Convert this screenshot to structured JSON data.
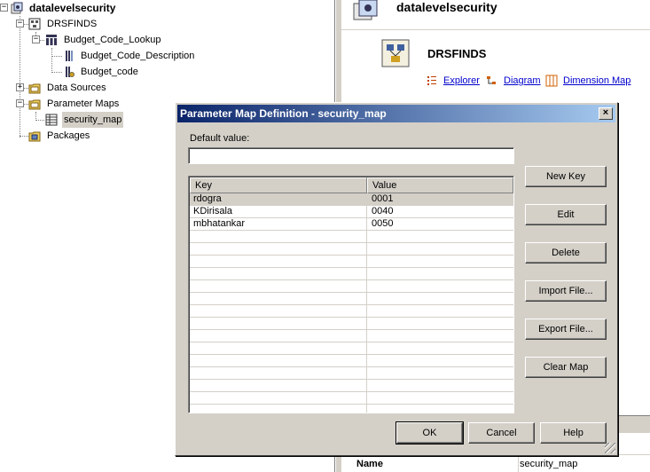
{
  "tree": {
    "root": "datalevelsecurity",
    "model": "DRSFINDS",
    "dimension": "Budget_Code_Lookup",
    "levels": [
      "Budget_Code_Description",
      "Budget_code"
    ],
    "data_sources": "Data Sources",
    "parameter_maps": "Parameter Maps",
    "security_map": "security_map",
    "packages": "Packages",
    "expander_minus": "−",
    "expander_plus": "+"
  },
  "right": {
    "title": "datalevelsecurity",
    "section": "DRSFINDS",
    "links": {
      "explorer": "Explorer",
      "diagram": "Diagram",
      "dimension_map": "Dimension Map"
    },
    "prop_name_label": "Name",
    "prop_name_value": "security_map"
  },
  "dialog": {
    "title": "Parameter Map Definition - security_map",
    "close": "×",
    "default_value_label": "Default value:",
    "default_value": "",
    "columns": [
      "Key",
      "Value"
    ],
    "rows": [
      {
        "key": "rdogra",
        "value": "0001"
      },
      {
        "key": "KDirisala",
        "value": "0040"
      },
      {
        "key": "mbhatankar",
        "value": "0050"
      }
    ],
    "buttons": {
      "new_key": "New Key",
      "edit": "Edit",
      "delete": "Delete",
      "import_file": "Import File...",
      "export_file": "Export File...",
      "clear_map": "Clear Map",
      "ok": "OK",
      "cancel": "Cancel",
      "help": "Help"
    }
  },
  "colors": {
    "titlebar_start": "#0a246a",
    "titlebar_end": "#a6caf0",
    "face": "#d4d0c8",
    "link": "#0000cc"
  }
}
